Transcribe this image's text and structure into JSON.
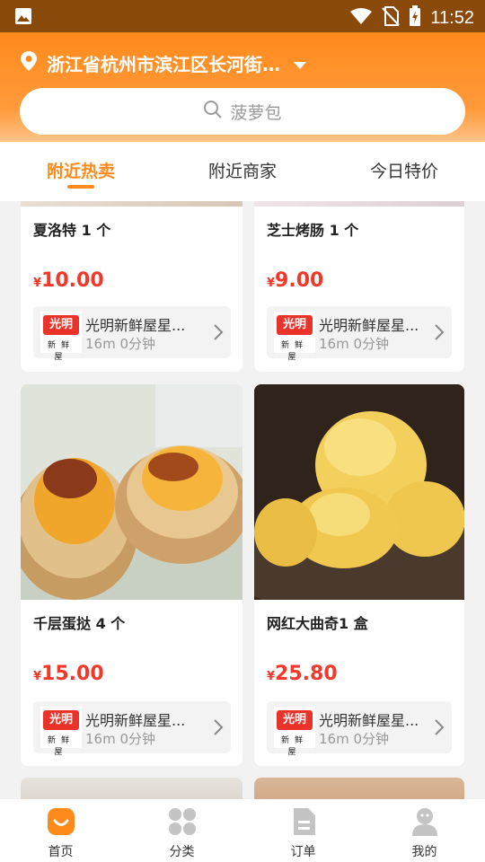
{
  "status_bar": {
    "time": "11:52"
  },
  "header": {
    "location": "浙江省杭州市滨江区长河街…",
    "search_placeholder": "菠萝包"
  },
  "tabs": [
    {
      "label": "附近热卖",
      "active": true
    },
    {
      "label": "附近商家",
      "active": false
    },
    {
      "label": "今日特价",
      "active": false
    }
  ],
  "products": [
    {
      "name": "夏洛特 1 个",
      "currency": "¥",
      "price": "10.00",
      "store": "光明新鲜屋星...",
      "meta": "16m 0分钟"
    },
    {
      "name": "芝士烤肠 1 个",
      "currency": "¥",
      "price": "9.00",
      "store": "光明新鲜屋星...",
      "meta": "16m 0分钟"
    },
    {
      "name": "千层蛋挞 4 个",
      "currency": "¥",
      "price": "15.00",
      "store": "光明新鲜屋星...",
      "meta": "16m 0分钟"
    },
    {
      "name": "网红大曲奇1 盒",
      "currency": "¥",
      "price": "25.80",
      "store": "光明新鲜屋星...",
      "meta": "16m 0分钟"
    }
  ],
  "store_logo": {
    "top": "光明",
    "bottom": "新鲜屋"
  },
  "bottom_nav": [
    {
      "label": "首页",
      "icon": "home-icon",
      "active": true
    },
    {
      "label": "分类",
      "icon": "category-icon",
      "active": false
    },
    {
      "label": "订单",
      "icon": "order-icon",
      "active": false
    },
    {
      "label": "我的",
      "icon": "profile-icon",
      "active": false
    }
  ],
  "colors": {
    "accent": "#ff8a1c",
    "price": "#f2382a",
    "status_bar": "#8a4a0c"
  }
}
